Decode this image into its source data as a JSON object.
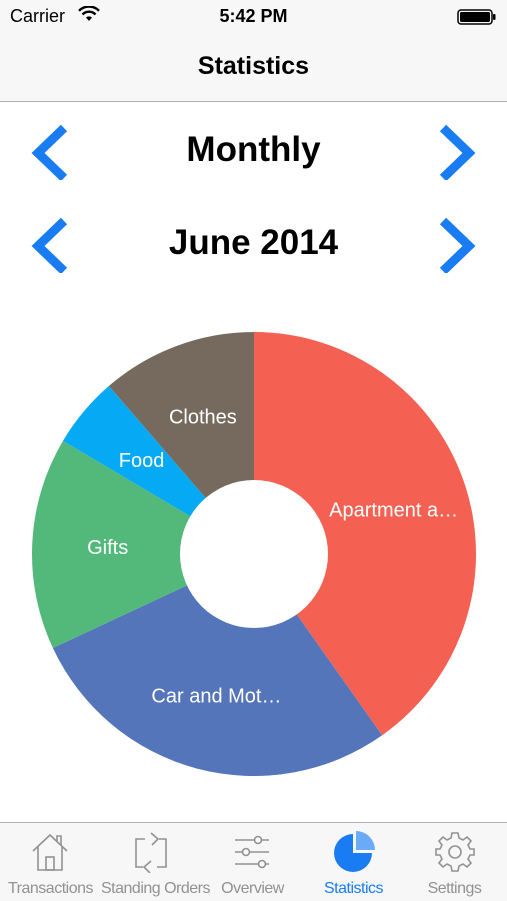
{
  "status_bar": {
    "carrier": "Carrier",
    "time": "5:42 PM"
  },
  "nav": {
    "title": "Statistics"
  },
  "period": {
    "label": "Monthly"
  },
  "date": {
    "label": "June 2014"
  },
  "colors": {
    "accent": "#1a7cf3",
    "tab_inactive": "#929292"
  },
  "chart_data": {
    "type": "pie",
    "title": "",
    "series": [
      {
        "label": "Apartment a…",
        "value": 39,
        "color": "#f46152"
      },
      {
        "label": "Car and Mot…",
        "value": 27,
        "color": "#5575bb"
      },
      {
        "label": "Gifts",
        "value": 15,
        "color": "#52b97a"
      },
      {
        "label": "Food",
        "value": 5,
        "color": "#06aaf4"
      },
      {
        "label": "Clothes",
        "value": 11,
        "color": "#766a5f"
      }
    ]
  },
  "tabs": [
    {
      "label": "Transactions",
      "icon": "house-icon",
      "active": false
    },
    {
      "label": "Standing Orders",
      "icon": "repeat-icon",
      "active": false
    },
    {
      "label": "Overview",
      "icon": "sliders-icon",
      "active": false
    },
    {
      "label": "Statistics",
      "icon": "pie-chart-icon",
      "active": true
    },
    {
      "label": "Settings",
      "icon": "gear-icon",
      "active": false
    }
  ]
}
